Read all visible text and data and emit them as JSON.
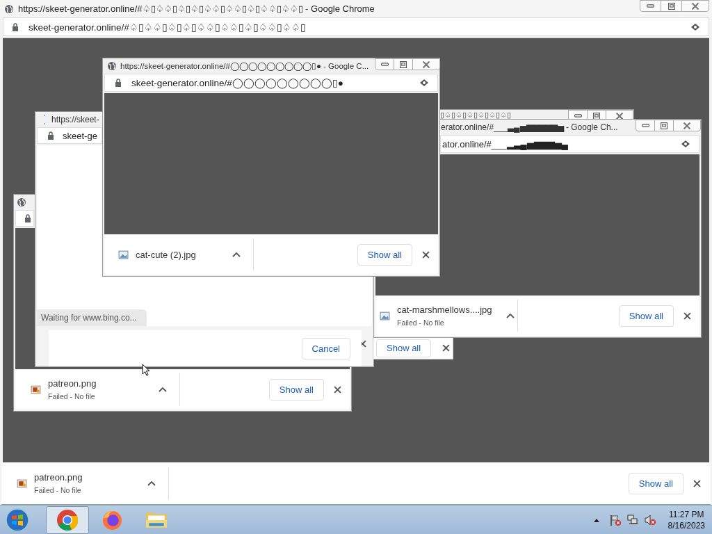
{
  "main_window": {
    "title": "https://skeet-generator.online/#♤▯♤♤▯♤▯♤▯♤♤▯♤♤▯♤▯♤♤▯♤♤▯ - Google Chrome",
    "address": "skeet-generator.online/#♤▯♤♤▯♤▯♤▯♤♤▯♤♤▯♤▯♤♤▯♤♤▯",
    "download": {
      "file": "patreon.png",
      "status": "Failed - No file",
      "show_all": "Show all"
    }
  },
  "left_window": {
    "download": {
      "file": "patreon.png",
      "status": "Failed - No file",
      "show_all": "Show all"
    }
  },
  "loading_window": {
    "title": "https://skeet-",
    "address": "skeet-ge",
    "status": "Waiting for www.bing.co...",
    "dialog": {
      "button": "Cancel"
    }
  },
  "behind_window": {
    "show_all": "Show all"
  },
  "back_window": {
    "title": "▯♤▯♤▯♤▯♤▯♤▯♤▯"
  },
  "right_window": {
    "title": "erator.online/#___▃▄▅▆▆▆▆▆▅ - Google Ch...",
    "address": "ator.online/#___▂▃▄▅▆▆▆▅▄",
    "download": {
      "file": "cat-marshmellows....jpg",
      "status": "Failed - No file",
      "show_all": "Show all"
    }
  },
  "front_window": {
    "title": "https://skeet-generator.online/#◯◯◯◯◯◯◯◯◯▯● - Google C...",
    "address": "skeet-generator.online/#◯◯◯◯◯◯◯◯◯▯●",
    "download": {
      "file": "cat-cute (2).jpg",
      "show_all": "Show all"
    }
  },
  "taskbar": {
    "apps": [
      {
        "kind": "chrome",
        "selected": true
      },
      {
        "kind": "firefox",
        "selected": false
      },
      {
        "kind": "folder",
        "selected": false
      }
    ],
    "time": "11:27 PM",
    "date": "8/16/2023"
  }
}
